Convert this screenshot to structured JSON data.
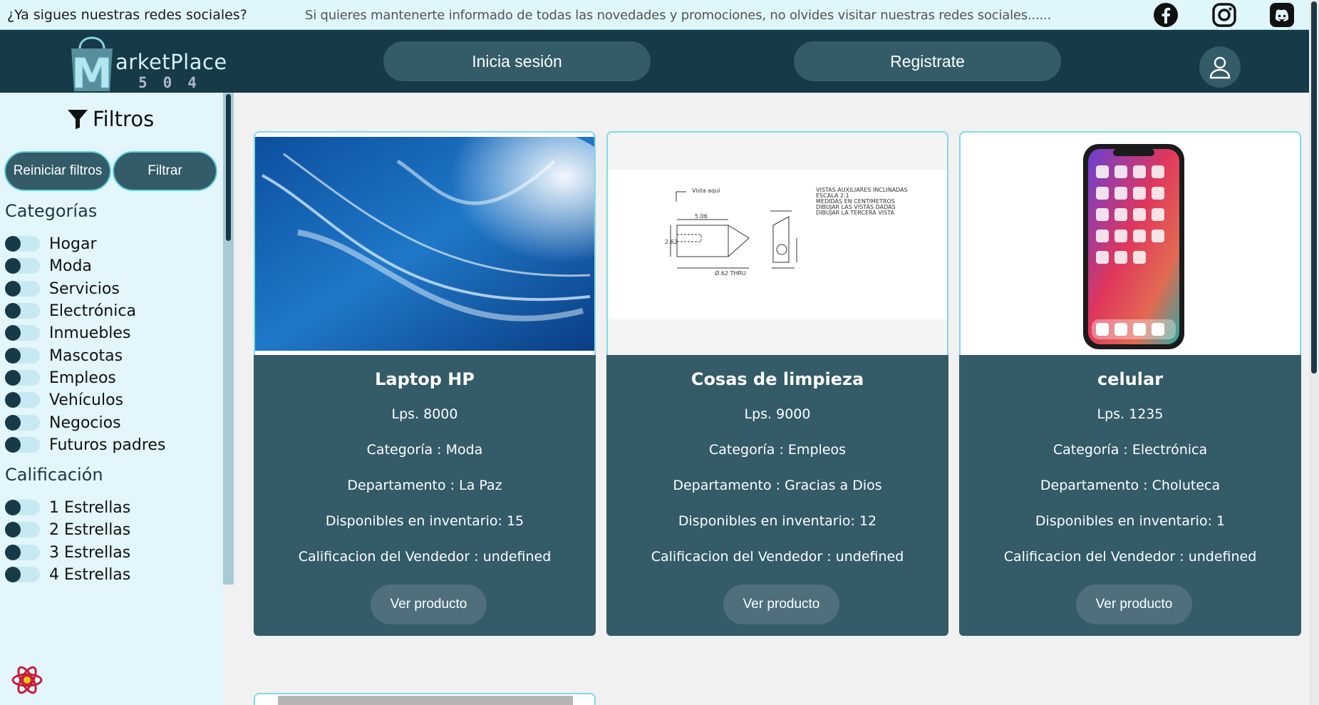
{
  "topbar": {
    "question": "¿Ya sigues nuestras redes sociales?",
    "message": "Si quieres mantenerte informado de todas las novedades y promociones, no olvides visitar nuestras redes sociales......",
    "icons": [
      "facebook-icon",
      "instagram-icon",
      "discord-icon"
    ]
  },
  "header": {
    "logo_text": "MarketPlace",
    "logo_brand_rest": "arketPlace",
    "logo_number": "504",
    "login_label": "Inicia sesión",
    "register_label": "Registrate",
    "profile_icon": "user-icon"
  },
  "sidebar": {
    "title": "Filtros",
    "reset_label": "Reiniciar filtros",
    "filter_label": "Filtrar",
    "categories_title": "Categorías",
    "categories": [
      "Hogar",
      "Moda",
      "Servicios",
      "Electrónica",
      "Inmuebles",
      "Mascotas",
      "Empleos",
      "Vehículos",
      "Negocios",
      "Futuros padres"
    ],
    "rating_title": "Calificación",
    "ratings": [
      "1 Estrellas",
      "2 Estrellas",
      "3 Estrellas",
      "4 Estrellas"
    ]
  },
  "products": [
    {
      "name": "Laptop HP",
      "price": "Lps. 8000",
      "category": "Categoría : Moda",
      "department": "Departamento : La Paz",
      "stock": "Disponibles en inventario: 15",
      "rating": "Calificacion del Vendedor : undefined",
      "button": "Ver producto"
    },
    {
      "name": "Cosas de limpieza",
      "price": "Lps. 9000",
      "category": "Categoría : Empleos",
      "department": "Departamento : Gracias a Dios",
      "stock": "Disponibles en inventario: 12",
      "rating": "Calificacion del Vendedor : undefined",
      "button": "Ver producto"
    },
    {
      "name": "celular",
      "price": "Lps. 1235",
      "category": "Categoría : Electrónica",
      "department": "Departamento : Choluteca",
      "stock": "Disponibles en inventario: 1",
      "rating": "Calificacion del Vendedor : undefined",
      "button": "Ver producto"
    }
  ],
  "colors": {
    "header_bg": "#163a48",
    "card_bg": "#335b68",
    "sidebar_bg": "#e3f6fb",
    "accent_border": "#7fdbe5"
  }
}
